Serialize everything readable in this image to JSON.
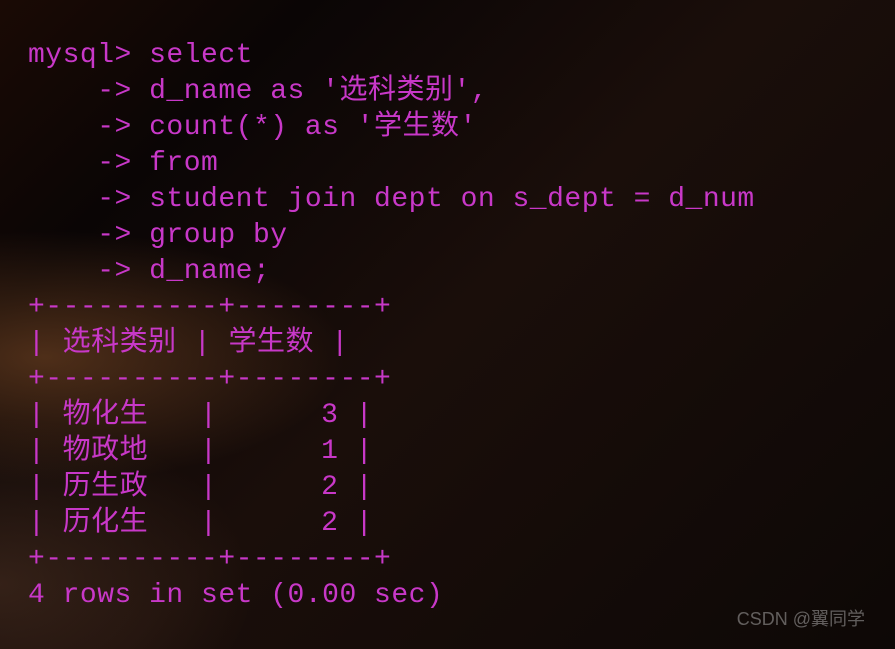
{
  "prompt": "mysql> ",
  "continuation": "    -> ",
  "query_lines": [
    "select",
    "d_name as '选科类别',",
    "count(*) as '学生数'",
    "from",
    "student join dept on s_dept = d_num",
    "group by",
    "d_name;"
  ],
  "table": {
    "separator": "+----------+--------+",
    "header": "| 选科类别 | 学生数 |",
    "rows": [
      {
        "col1": "物化生",
        "col2": "3"
      },
      {
        "col1": "物政地",
        "col2": "1"
      },
      {
        "col1": "历生政",
        "col2": "2"
      },
      {
        "col1": "历化生",
        "col2": "2"
      }
    ]
  },
  "status": "4 rows in set (0.00 sec)",
  "watermark": "CSDN @翼同学"
}
